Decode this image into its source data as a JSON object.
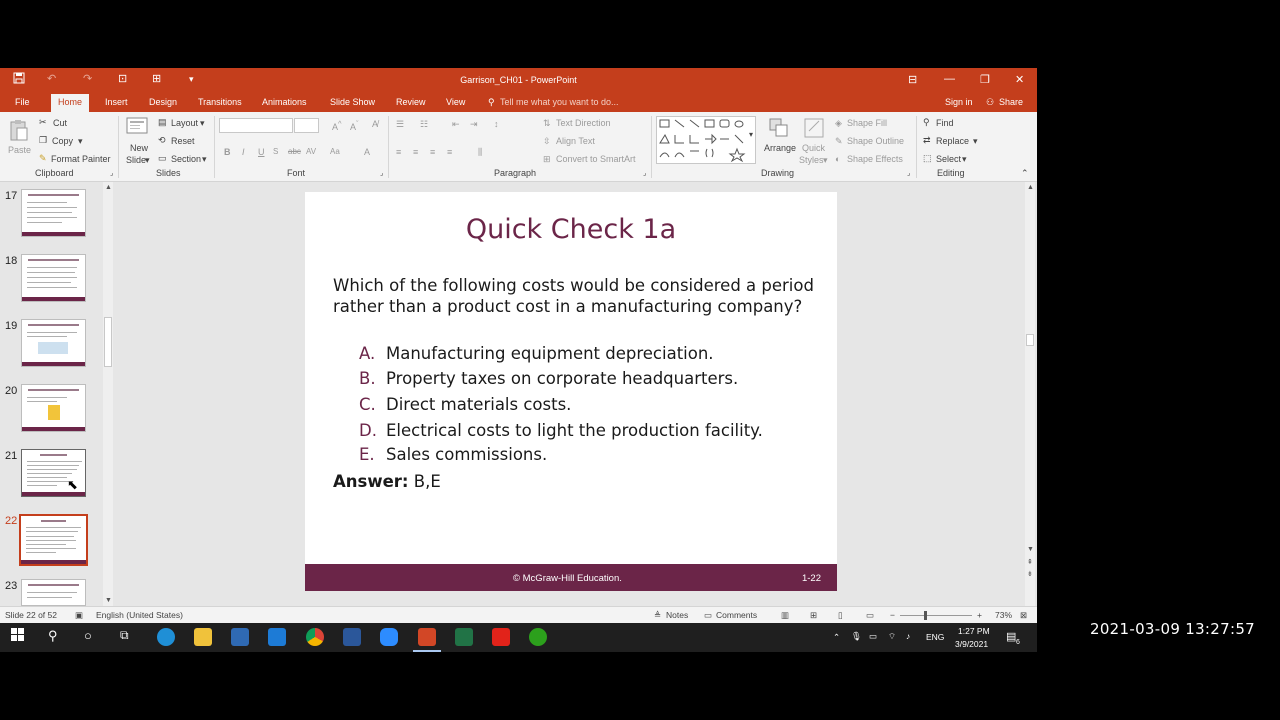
{
  "window": {
    "title": "Garrison_CH01 - PowerPoint",
    "tabs": [
      "File",
      "Home",
      "Insert",
      "Design",
      "Transitions",
      "Animations",
      "Slide Show",
      "Review",
      "View"
    ],
    "tell_me": "Tell me what you want to do...",
    "sign_in": "Sign in",
    "share": "Share"
  },
  "ribbon": {
    "clipboard": {
      "paste": "Paste",
      "cut": "Cut",
      "copy": "Copy",
      "format_painter": "Format Painter",
      "label": "Clipboard"
    },
    "slides": {
      "new_slide": "New",
      "new_slide2": "Slide",
      "layout": "Layout",
      "reset": "Reset",
      "section": "Section",
      "label": "Slides"
    },
    "font": {
      "label": "Font",
      "bold": "B",
      "italic": "I",
      "underline": "U",
      "strike": "abc",
      "spacing": "AV",
      "case": "Aa",
      "color": "A"
    },
    "paragraph": {
      "text_direction": "Text Direction",
      "align_text": "Align Text",
      "convert_smartart": "Convert to SmartArt",
      "label": "Paragraph"
    },
    "drawing": {
      "arrange": "Arrange",
      "quick": "Quick",
      "styles": "Styles",
      "shape_fill": "Shape Fill",
      "shape_outline": "Shape Outline",
      "shape_effects": "Shape Effects",
      "label": "Drawing"
    },
    "editing": {
      "find": "Find",
      "replace": "Replace",
      "select": "Select",
      "label": "Editing"
    }
  },
  "thumbnails": [
    "17",
    "18",
    "19",
    "20",
    "21",
    "22",
    "23"
  ],
  "slide": {
    "title": "Quick Check 1a",
    "question": "Which of the following costs would be considered a period rather than a product cost in a manufacturing company?",
    "options": [
      {
        "letter": "A.",
        "text": "Manufacturing equipment depreciation."
      },
      {
        "letter": "B.",
        "text": "Property taxes on corporate headquarters."
      },
      {
        "letter": "C.",
        "text": "Direct materials costs."
      },
      {
        "letter": "D.",
        "text": "Electrical costs to light the production facility."
      },
      {
        "letter": "E.",
        "text": "Sales commissions."
      }
    ],
    "answer_label": "Answer:",
    "answer_value": "B,E",
    "footer_copyright": "© McGraw-Hill Education.",
    "footer_page": "1-22"
  },
  "status": {
    "slide_of": "Slide 22 of 52",
    "language": "English (United States)",
    "notes": "Notes",
    "comments": "Comments",
    "zoom": "73%"
  },
  "taskbar": {
    "lang": "ENG",
    "time": "1:27 PM",
    "date": "3/9/2021",
    "notif_count": "6"
  },
  "timestamp": "2021-03-09 13:27:57",
  "colors": {
    "accent": "#c43e1c",
    "slide_primary": "#6b2548"
  }
}
